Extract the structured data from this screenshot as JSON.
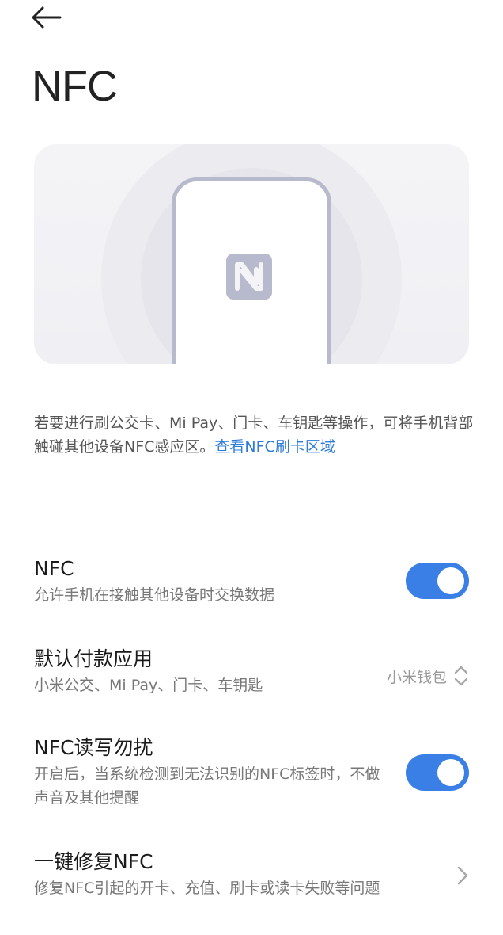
{
  "header": {
    "title": "NFC"
  },
  "description": {
    "text": "若要进行刷公交卡、Mi Pay、门卡、车钥匙等操作，可将手机背部触碰其他设备NFC感应区。",
    "link": "查看NFC刷卡区域"
  },
  "settings": [
    {
      "title": "NFC",
      "subtitle": "允许手机在接触其他设备时交换数据",
      "control": "toggle",
      "enabled": true
    },
    {
      "title": "默认付款应用",
      "subtitle": "小米公交、Mi Pay、门卡、车钥匙",
      "control": "select",
      "value": "小米钱包"
    },
    {
      "title": "NFC读写勿扰",
      "subtitle": "开启后，当系统检测到无法识别的NFC标签时，不做声音及其他提醒",
      "control": "toggle",
      "enabled": true
    },
    {
      "title": "一键修复NFC",
      "subtitle": "修复NFC引起的开卡、充值、刷卡或读卡失败等问题",
      "control": "chevron"
    }
  ],
  "colors": {
    "accent": "#3a7fe6",
    "link": "#2f7bd8"
  },
  "icons": {
    "back": "arrow-left-icon",
    "nfc": "nfc-icon",
    "select": "chevron-up-down-icon",
    "chevron": "chevron-right-icon"
  }
}
